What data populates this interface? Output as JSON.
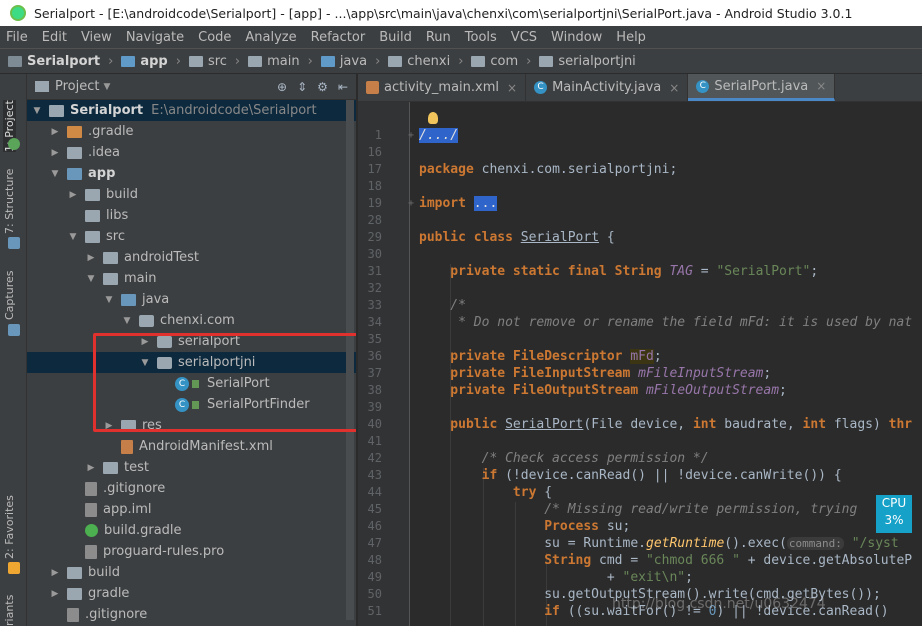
{
  "titlebar": {
    "title": "Serialport - [E:\\androidcode\\Serialport] - [app] - ...\\app\\src\\main\\java\\chenxi\\com\\serialportjni\\SerialPort.java - Android Studio 3.0.1"
  },
  "menu": [
    "File",
    "Edit",
    "View",
    "Navigate",
    "Code",
    "Analyze",
    "Refactor",
    "Build",
    "Run",
    "Tools",
    "VCS",
    "Window",
    "Help"
  ],
  "breadcrumbs": [
    "Serialport",
    "app",
    "src",
    "main",
    "java",
    "chenxi",
    "com",
    "serialportjni"
  ],
  "left_strip": {
    "project": "1: Project",
    "structure": "7: Structure",
    "captures": "Captures",
    "favorites": "2: Favorites",
    "variants": "riants"
  },
  "project_panel": {
    "title": "Project"
  },
  "tree": [
    {
      "label": "Serialport",
      "path": "E:\\androidcode\\Serialport"
    },
    {
      "label": ".gradle"
    },
    {
      "label": ".idea"
    },
    {
      "label": "app"
    },
    {
      "label": "build"
    },
    {
      "label": "libs"
    },
    {
      "label": "src"
    },
    {
      "label": "androidTest"
    },
    {
      "label": "main"
    },
    {
      "label": "java"
    },
    {
      "label": "chenxi.com"
    },
    {
      "label": "serialport"
    },
    {
      "label": "serialportjni"
    },
    {
      "label": "SerialPort"
    },
    {
      "label": "SerialPortFinder"
    },
    {
      "label": "res"
    },
    {
      "label": "AndroidManifest.xml"
    },
    {
      "label": "test"
    },
    {
      "label": ".gitignore"
    },
    {
      "label": "app.iml"
    },
    {
      "label": "build.gradle"
    },
    {
      "label": "proguard-rules.pro"
    },
    {
      "label": "build"
    },
    {
      "label": "gradle"
    },
    {
      "label": ".gitignore"
    }
  ],
  "tabs": [
    {
      "label": "activity_main.xml"
    },
    {
      "label": "MainActivity.java"
    },
    {
      "label": "SerialPort.java"
    }
  ],
  "editor": {
    "line_numbers": [
      "1",
      "16",
      "17",
      "18",
      "19",
      "28",
      "29",
      "30",
      "31",
      "32",
      "33",
      "34",
      "35",
      "36",
      "37",
      "38",
      "39",
      "40",
      "41",
      "42",
      "43",
      "44",
      "45",
      "46",
      "47",
      "48",
      "49",
      "50",
      "51"
    ],
    "lines": {
      "l1": "/.../",
      "l17a": "package ",
      "l17b": "chenxi.com.serialportjni;",
      "l19a": "import ",
      "l19b": "...",
      "l29a": "public class ",
      "l29b": "SerialPort",
      "l29c": " {",
      "l31a": "    private static final ",
      "l31b": "String ",
      "l31c": "TAG",
      "l31d": " = ",
      "l31e": "\"SerialPort\"",
      "l31f": ";",
      "l33": "    /*",
      "l34": "     * Do not remove or rename the field mFd: it is used by nat",
      "l36a": "    private ",
      "l36b": "FileDescriptor ",
      "l36c": "mFd",
      "l36d": ";",
      "l37a": "    private ",
      "l37b": "FileInputStream ",
      "l37c": "mFileInputStream",
      "l37d": ";",
      "l38a": "    private ",
      "l38b": "FileOutputStream ",
      "l38c": "mFileOutputStream",
      "l38d": ";",
      "l40a": "    public ",
      "l40b": "SerialPort",
      "l40c": "(File device, ",
      "l40d": "int ",
      "l40e": "baudrate, ",
      "l40f": "int ",
      "l40g": "flags) ",
      "l40h": "thr",
      "l42": "        /* Check access permission */",
      "l43a": "        if ",
      "l43b": "(!device.canRead() || !device.canWrite()) {",
      "l44a": "            try ",
      "l44b": "{",
      "l45": "                /* Missing read/write permission, trying",
      "l46a": "                Process ",
      "l46b": "su;",
      "l47a": "                su = ",
      "l47b": "Runtime.",
      "l47c": "getRuntime",
      "l47d": "().exec(",
      "l47e": "command:",
      "l47f": " \"/syst",
      "l48a": "                String ",
      "l48b": "cmd = ",
      "l48c": "\"chmod 666 \"",
      "l48d": " + device.getAbsoluteP",
      "l49a": "                        + ",
      "l49b": "\"exit\\n\"",
      "l49c": ";",
      "l50": "                su.getOutputStream().write(cmd.getBytes());",
      "l51a": "                if ",
      "l51b": "((su.waitFor() != ",
      "l51c": "0",
      "l51d": ") || !device.canRead()"
    }
  },
  "cpu_widget": {
    "label": "CPU",
    "value": "3%"
  },
  "watermark": "http://blog.csdn.net/u0632474"
}
